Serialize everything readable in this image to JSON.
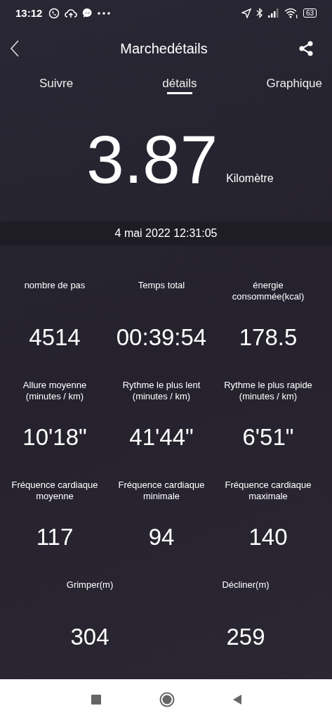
{
  "status_bar": {
    "time": "13:12",
    "battery": "63"
  },
  "header": {
    "title": "Marchedétails"
  },
  "tabs": [
    {
      "label": "Suivre",
      "selected": false
    },
    {
      "label": "détails",
      "selected": true
    },
    {
      "label": "Graphique",
      "selected": false
    }
  ],
  "distance": {
    "value": "3.87",
    "unit": "Kilomètre"
  },
  "date": "4 mai 2022 12:31:05",
  "stat_rows": [
    {
      "stats": [
        {
          "label": "nombre de pas",
          "value": "4514"
        },
        {
          "label": "Temps total",
          "value": "00:39:54"
        },
        {
          "label": "énergie consommée(kcal)",
          "value": "178.5"
        }
      ]
    },
    {
      "stats": [
        {
          "label": "Allure moyenne (minutes / km)",
          "value": "10'18\""
        },
        {
          "label": "Rythme le plus lent (minutes / km)",
          "value": "41'44\""
        },
        {
          "label": "Rythme le plus rapide (minutes / km)",
          "value": "6'51\""
        }
      ]
    },
    {
      "stats": [
        {
          "label": "Fréquence cardiaque moyenne",
          "value": "117"
        },
        {
          "label": "Fréquence cardiaque minimale",
          "value": "94"
        },
        {
          "label": "Fréquence cardiaque maximale",
          "value": "140"
        }
      ]
    },
    {
      "stats": [
        {
          "label": "Grimper(m)",
          "value": "304"
        },
        {
          "label": "Décliner(m)",
          "value": "259"
        }
      ]
    }
  ]
}
